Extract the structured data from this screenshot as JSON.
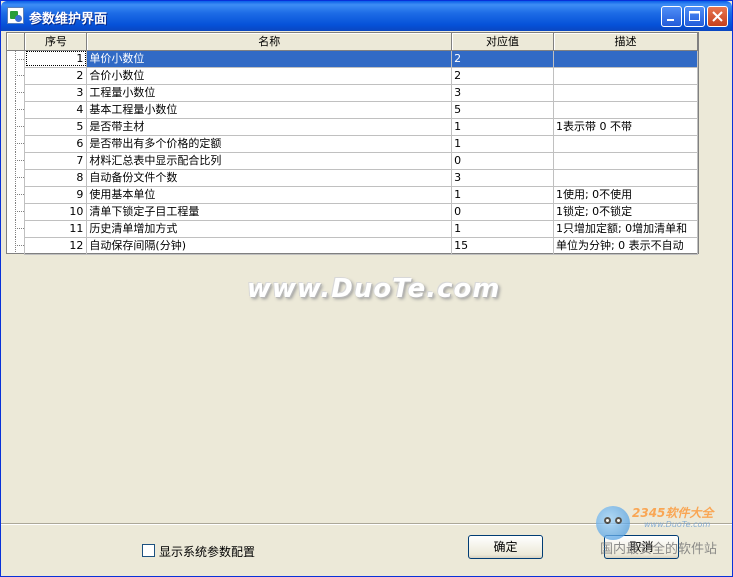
{
  "window": {
    "title": "参数维护界面",
    "buttons": {
      "minimize": "minimize",
      "maximize": "maximize",
      "close": "close"
    }
  },
  "table": {
    "columns": [
      "序号",
      "名称",
      "对应值",
      "描述"
    ],
    "rows": [
      {
        "no": "1",
        "name": "单价小数位",
        "value": "2",
        "desc": ""
      },
      {
        "no": "2",
        "name": "合价小数位",
        "value": "2",
        "desc": ""
      },
      {
        "no": "3",
        "name": "工程量小数位",
        "value": "3",
        "desc": ""
      },
      {
        "no": "4",
        "name": "基本工程量小数位",
        "value": "5",
        "desc": ""
      },
      {
        "no": "5",
        "name": "是否带主材",
        "value": "1",
        "desc": "1表示带 0 不带"
      },
      {
        "no": "6",
        "name": "是否带出有多个价格的定额",
        "value": "1",
        "desc": ""
      },
      {
        "no": "7",
        "name": "材料汇总表中显示配合比列",
        "value": "0",
        "desc": ""
      },
      {
        "no": "8",
        "name": "自动备份文件个数",
        "value": "3",
        "desc": ""
      },
      {
        "no": "9",
        "name": "使用基本单位",
        "value": "1",
        "desc": "1使用; 0不使用"
      },
      {
        "no": "10",
        "name": "清单下锁定子目工程量",
        "value": "0",
        "desc": "1锁定; 0不锁定"
      },
      {
        "no": "11",
        "name": "历史清单增加方式",
        "value": "1",
        "desc": "1只增加定额; 0增加清单和"
      },
      {
        "no": "12",
        "name": "自动保存间隔(分钟)",
        "value": "15",
        "desc": "单位为分钟; 0 表示不自动"
      }
    ],
    "selected_row": 1
  },
  "watermark": "www.DuoTe.com",
  "footer": {
    "show_system_label": "显示系统参数配置",
    "ok_label": "确定",
    "cancel_label": "取消"
  },
  "logo": {
    "brand": "2345软件大全",
    "url": "www.DuoTe.com",
    "text": "国内最安全的软件站"
  }
}
